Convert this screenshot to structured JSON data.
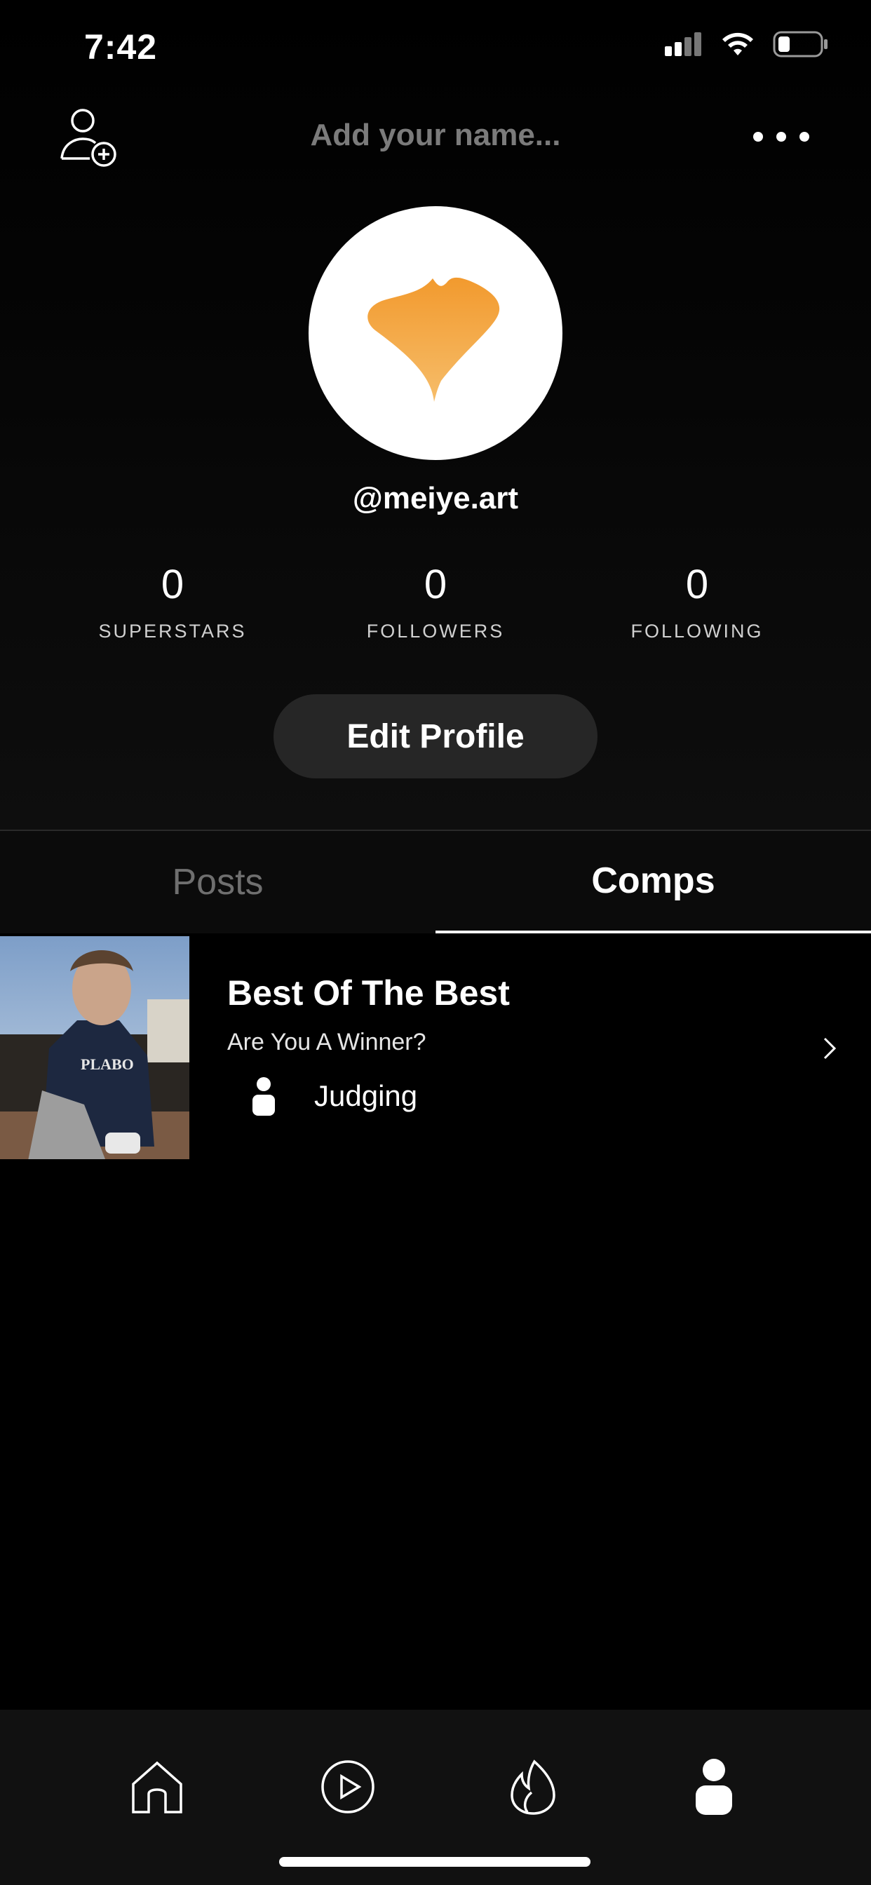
{
  "status_bar": {
    "time": "7:42"
  },
  "header": {
    "name_placeholder": "Add your name..."
  },
  "profile": {
    "username": "@meiye.art",
    "stats": [
      {
        "value": "0",
        "label": "SUPERSTARS"
      },
      {
        "value": "0",
        "label": "FOLLOWERS"
      },
      {
        "value": "0",
        "label": "FOLLOWING"
      }
    ],
    "edit_button": "Edit Profile",
    "avatar_color": "#F0A040"
  },
  "tabs": {
    "posts": "Posts",
    "comps": "Comps",
    "active": "comps"
  },
  "comps": [
    {
      "title": "Best Of The Best",
      "subtitle": "Are You A Winner?",
      "status": "Judging"
    }
  ],
  "bottom_nav": {
    "items": [
      "home-icon",
      "play-icon",
      "fire-icon",
      "profile-icon"
    ],
    "active": "profile-icon"
  }
}
